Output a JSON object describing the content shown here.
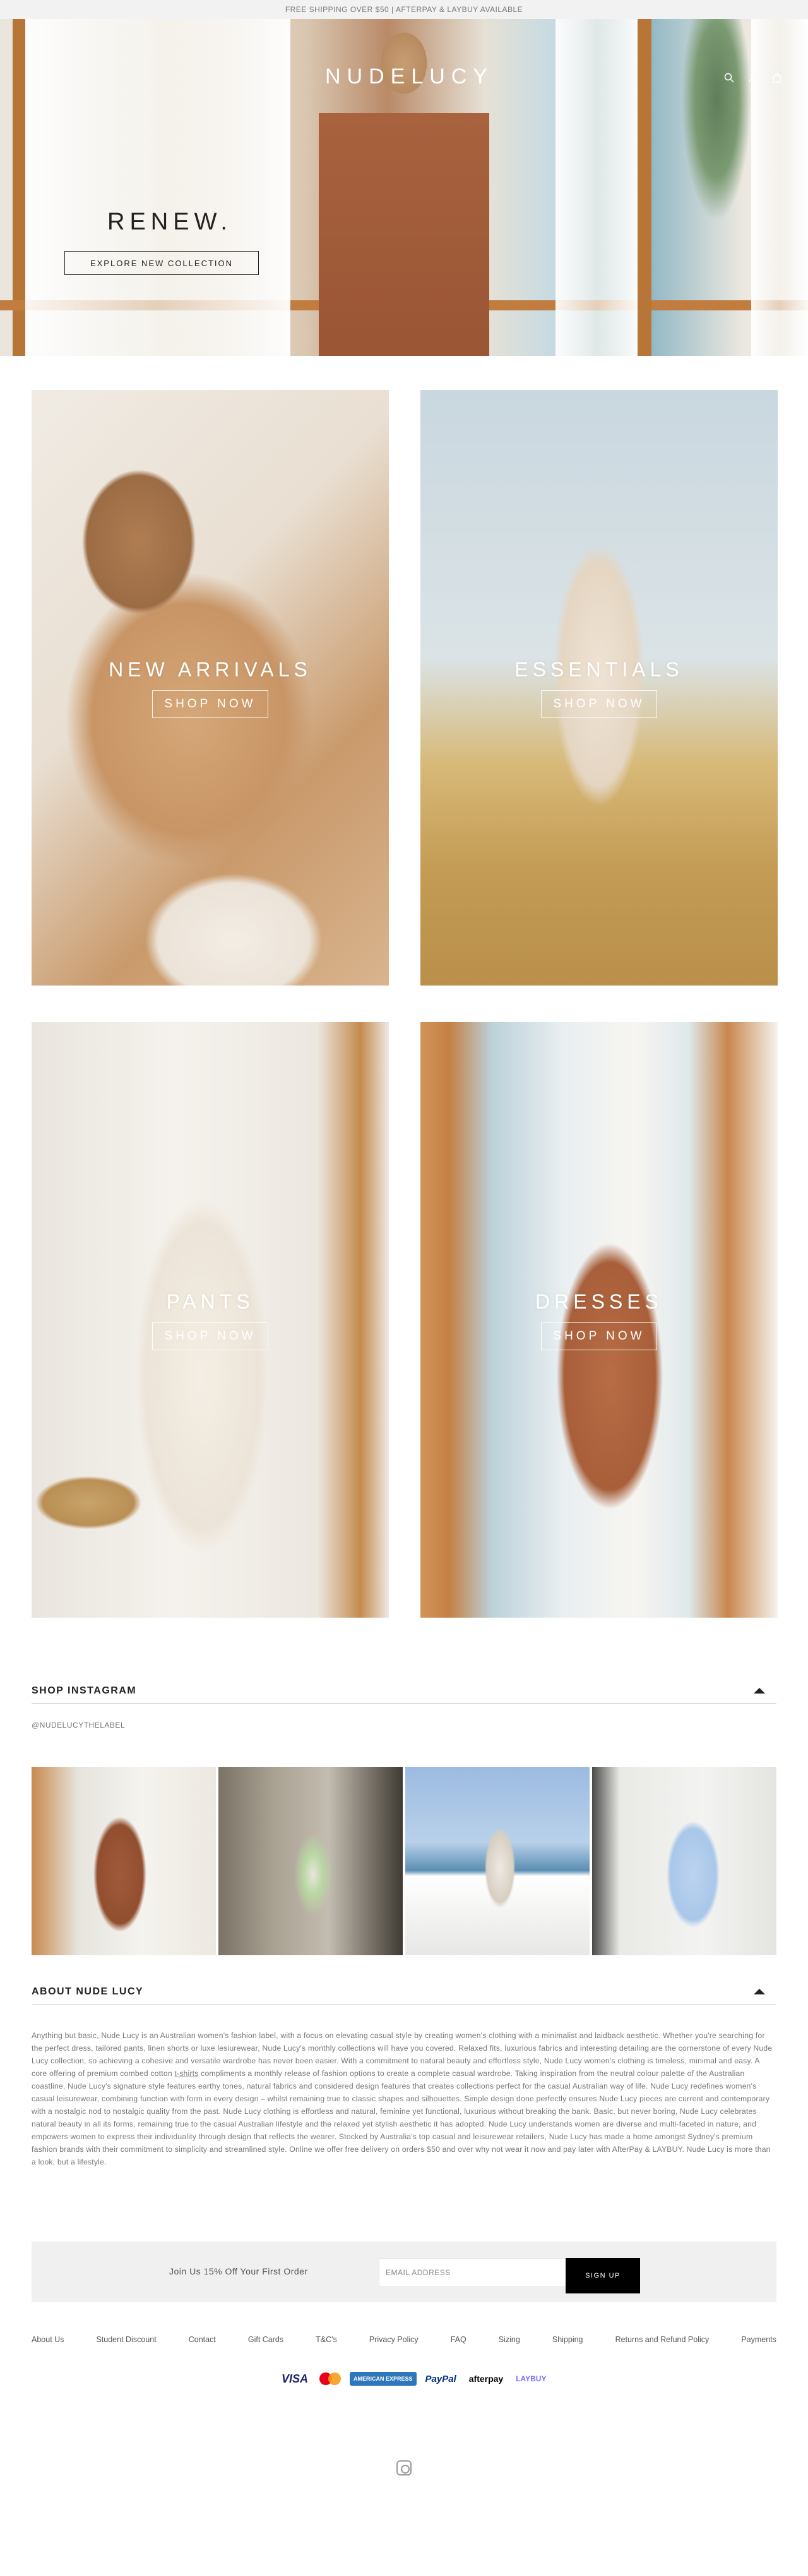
{
  "announcement": "FREE SHIPPING OVER $50 | AFTERPAY & LAYBUY AVAILABLE",
  "header": {
    "logo": "NUDELUCY",
    "icons": [
      "search-icon",
      "account-icon",
      "cart-icon"
    ]
  },
  "hero": {
    "title": "RENEW.",
    "button": "EXPLORE NEW COLLECTION"
  },
  "collections": [
    {
      "title": "NEW ARRIVALS",
      "button": "SHOP NOW"
    },
    {
      "title": "ESSENTIALS",
      "button": "SHOP NOW"
    },
    {
      "title": "PANTS",
      "button": "SHOP NOW"
    },
    {
      "title": "DRESSES",
      "button": "SHOP NOW"
    }
  ],
  "instagram": {
    "heading": "SHOP INSTAGRAM",
    "handle": "@NUDELUCYTHELABEL"
  },
  "about": {
    "heading": "ABOUT NUDE LUCY",
    "text_before_link": "Anything but basic, Nude Lucy is an Australian women's fashion label, with a focus on elevating casual style by creating women's clothing with a minimalist and laidback aesthetic. Whether you're searching for the perfect dress, tailored pants, linen shorts or luxe lesiurewear, Nude Lucy's monthly collections will have you covered. Relaxed fits, luxurious fabrics and interesting detailing are the cornerstone of every Nude Lucy collection, so achieving a cohesive and versatile wardrobe has never been easier. With a commitment to natural beauty and effortless style, Nude Lucy women's clothing is timeless, minimal and easy. A core offering of premium combed cotton ",
    "link": "t-shirts",
    "text_after_link": " compliments a monthly release of fashion options to create a complete casual wardrobe. Taking inspiration from the neutral colour palette of the Australian coastline, Nude Lucy's signature style features earthy tones, natural fabrics and considered design features that creates collections perfect for the casual Australian way of life. Nude Lucy redefines women's casual leisurewear, combining function with form in every design – whilst remaining true to classic shapes and silhouettes. Simple design done perfectly ensures Nude Lucy pieces are current and contemporary with a nostalgic nod to nostalgic quality from the past. Nude Lucy clothing is effortless and natural, feminine yet functional, luxurious without breaking the bank. Basic, but never boring, Nude Lucy celebrates natural beauty in all its forms, remaining true to the casual Australian lifestyle and the relaxed yet stylish aesthetic it has adopted. Nude Lucy understands women are diverse and multi-faceted in nature, and empowers women to express their individuality through design that reflects the wearer. Stocked by Australia's top casual and leisurewear retailers, Nude Lucy has made a home amongst Sydney's premium fashion brands with their commitment to simplicity and streamlined style. Online we offer free delivery on orders $50 and over why not wear it now and pay later with AfterPay & LAYBUY. Nude Lucy is more than a look, but a lifestyle."
  },
  "newsletter": {
    "label": "Join Us 15% Off Your First Order",
    "placeholder": "EMAIL ADDRESS",
    "button": "SIGN UP"
  },
  "footer": {
    "links": [
      "About Us",
      "Student Discount",
      "Contact",
      "Gift Cards",
      "T&C's",
      "Privacy Policy",
      "FAQ",
      "Sizing",
      "Shipping",
      "Returns and Refund Policy",
      "Payments"
    ],
    "payments": {
      "visa": "VISA",
      "amex": "AMERICAN EXPRESS",
      "paypal": "PayPal",
      "afterpay": "afterpay",
      "laybuy": "LAYBUY"
    }
  }
}
